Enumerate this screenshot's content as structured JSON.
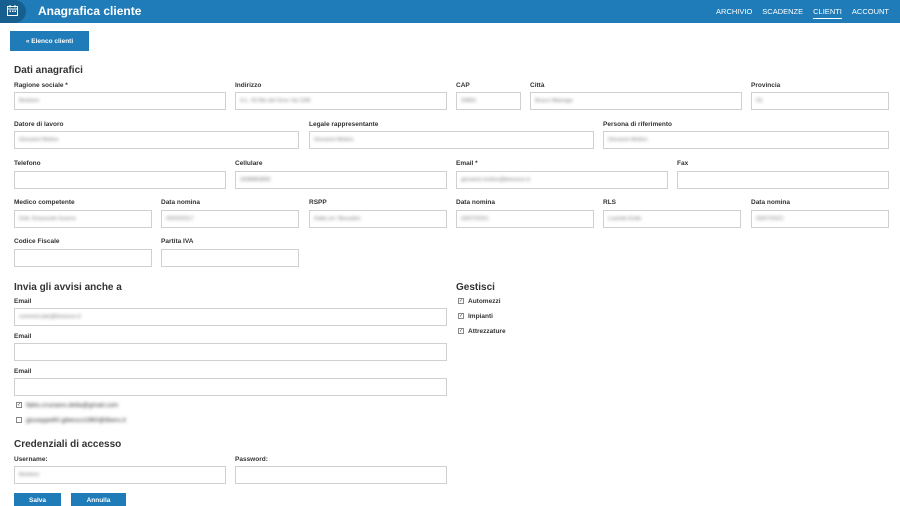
{
  "header": {
    "title": "Anagrafica cliente",
    "nav": [
      "ARCHIVIO",
      "SCADENZE",
      "CLIENTI",
      "ACCOUNT"
    ],
    "active_nav": "CLIENTI"
  },
  "back_button": "« Elenco clienti",
  "dati": {
    "title": "Dati anagrafici",
    "ragione_sociale": {
      "label": "Ragione sociale *",
      "value": "Beeleen"
    },
    "indirizzo": {
      "label": "Indirizzo",
      "value": "S.L. 50 Bis del Gres Vai 10/8"
    },
    "cap": {
      "label": "CAP",
      "value": "20891"
    },
    "citta": {
      "label": "Città",
      "value": "Bosco Mainago"
    },
    "provincia": {
      "label": "Provincia",
      "value": "OL"
    },
    "datore": {
      "label": "Datore di lavoro",
      "value": "Giovanni Molino"
    },
    "legale": {
      "label": "Legale rappresentante",
      "value": "Giovanni Molino"
    },
    "persona": {
      "label": "Persona di riferimento",
      "value": "Giovanni Molino"
    },
    "telefono": {
      "label": "Telefono",
      "value": ""
    },
    "cellulare": {
      "label": "Cellulare",
      "value": "3398883890"
    },
    "email": {
      "label": "Email *",
      "value": "giovanni.molino@beesovn.it"
    },
    "fax": {
      "label": "Fax",
      "value": ""
    },
    "medico": {
      "label": "Medico competente",
      "value": "Dott. Emanuele Guerra"
    },
    "data_nomina1": {
      "label": "Data nomina",
      "value": "03/03/2017"
    },
    "rspp": {
      "label": "RSPP",
      "value": "Dalta srl / Beusden"
    },
    "data_nomina2": {
      "label": "Data nomina",
      "value": "03/07/2021"
    },
    "rls": {
      "label": "RLS",
      "value": "Lusindo Erdis"
    },
    "data_nomina3": {
      "label": "Data nomina",
      "value": "03/07/2021"
    },
    "codice_fiscale": {
      "label": "Codice Fiscale",
      "value": ""
    },
    "partita_iva": {
      "label": "Partita IVA",
      "value": ""
    }
  },
  "avvisi": {
    "title": "Invia gli avvisi anche a",
    "emails": [
      {
        "label": "Email",
        "value": "commerciale@beesovn.it"
      },
      {
        "label": "Email",
        "value": ""
      },
      {
        "label": "Email",
        "value": ""
      }
    ],
    "checks": [
      {
        "label": "fabio.cruciano.della@gmail.com",
        "checked": true
      },
      {
        "label": "giuseppe60.gibesco1960@libero.it",
        "checked": false
      }
    ]
  },
  "gestisci": {
    "title": "Gestisci",
    "items": [
      {
        "label": "Automezzi",
        "checked": true
      },
      {
        "label": "Impianti",
        "checked": true
      },
      {
        "label": "Attrezzature",
        "checked": true
      }
    ]
  },
  "credenziali": {
    "title": "Credenziali di accesso",
    "username": {
      "label": "Username:",
      "value": "Beeleen"
    },
    "password": {
      "label": "Password:",
      "value": ""
    }
  },
  "buttons": {
    "save": "Salva",
    "cancel": "Annulla"
  },
  "colors": {
    "primary": "#1f7cb9",
    "primary_dark": "#175f8f"
  }
}
